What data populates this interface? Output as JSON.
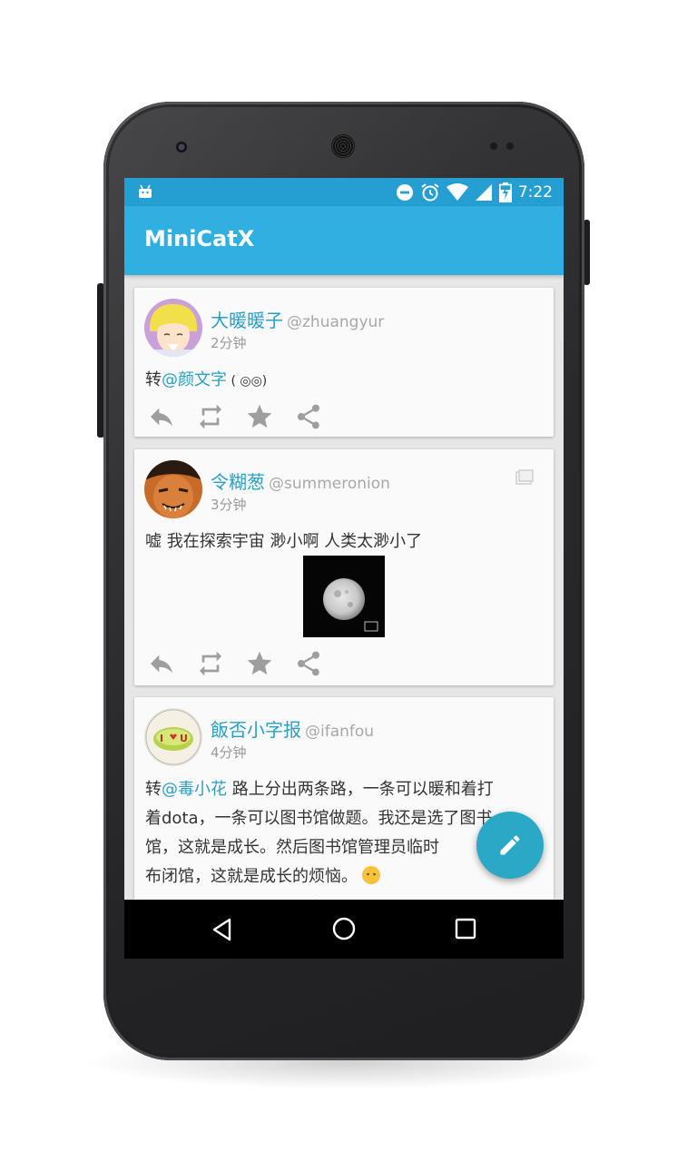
{
  "status_bar": {
    "time": "7:22"
  },
  "app_bar": {
    "title": "MiniCatX"
  },
  "posts": [
    {
      "name": "大暖暖子",
      "handle": "@zhuangyur",
      "time": "2分钟",
      "prefix": "转",
      "mention": "@颜文字",
      "text": " ( ◎◎)"
    },
    {
      "name": "令糊葱",
      "handle": "@summeronion",
      "time": "3分钟",
      "text": "嘘 我在探索宇宙 渺小啊 人类太渺小了",
      "has_photo": true
    },
    {
      "name": "飯否小字报",
      "handle": "@ifanfou",
      "time": "4分钟",
      "prefix": "转",
      "mention": "@毒小花",
      "text_lines": [
        " 路上分出两条路，一条可以暖和着打",
        "着dota，一条可以图书馆做题。我还是选了图书",
        "馆，这就是成长。然后图书馆管理员临时",
        "布闭馆，这就是成长的烦恼。"
      ]
    }
  ],
  "colors": {
    "status_bar": "#259fd1",
    "app_bar": "#2fb0e0",
    "accent": "#2a9fc4",
    "fab": "#2aa8c6"
  }
}
